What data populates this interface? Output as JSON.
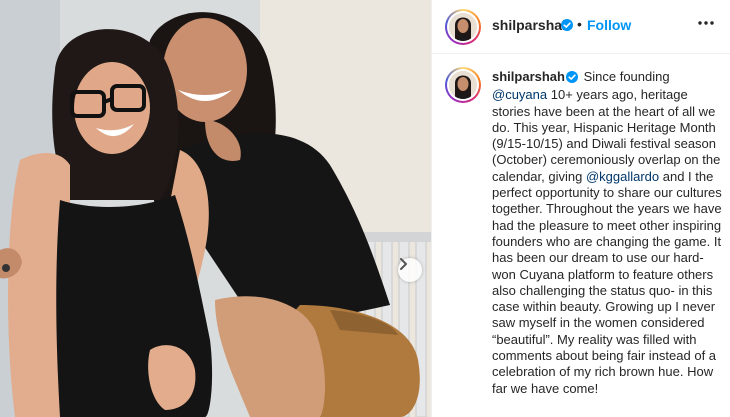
{
  "post": {
    "username": "shilparshah",
    "follow_label": "Follow",
    "separator": "•",
    "caption": {
      "username": "shilparshah",
      "seg1": " Since founding ",
      "mention1": "@cuyana",
      "seg2": " 10+ years ago, heritage stories have been at the heart of all we do. This year, Hispanic Heritage Month (9/15-10/15) and Diwali festival season (October) ceremoniously overlap on the calendar, giving ",
      "mention2": "@kggallardo",
      "seg3": " and I the perfect opportunity to share our cultures together. Throughout the years we have had the pleasure to meet other inspiring founders who are changing the game. It has been our dream to use our hard-won Cuyana platform to feature others also challenging the status quo- in this case within beauty. Growing up I never saw myself in the women considered “beautiful”. My reality was filled with comments about being fair instead of a celebration of my rich brown hue. How far we have come!"
    }
  },
  "icons": {
    "verified": "verified-badge-icon",
    "more": "more-options-icon",
    "next": "chevron-right-icon"
  },
  "colors": {
    "follow_blue": "#0095f6",
    "mention_blue": "#00376b",
    "verified_blue": "#0095f6"
  }
}
